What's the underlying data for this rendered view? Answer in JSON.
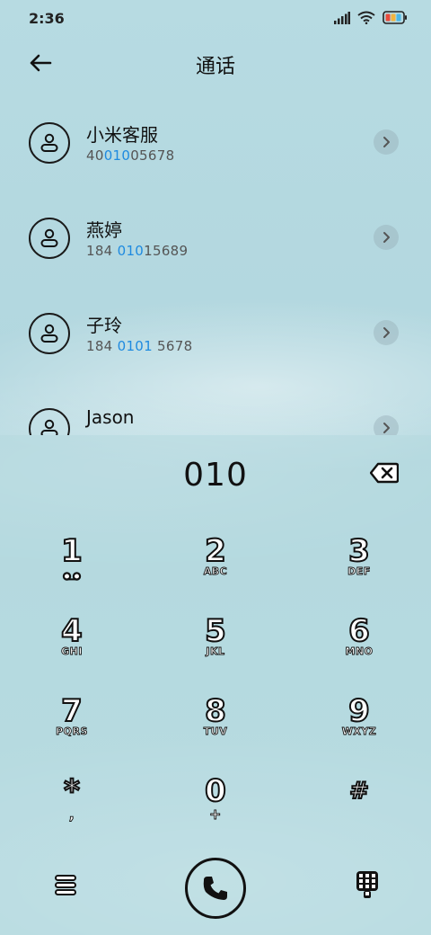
{
  "status": {
    "time": "2:36"
  },
  "header": {
    "title": "通话"
  },
  "contacts": [
    {
      "name": "小米客服",
      "num_pre": "40",
      "num_hl": "010",
      "num_post": "05678"
    },
    {
      "name": "燕婷",
      "num_pre": "184 ",
      "num_hl": "010",
      "num_post": "15689"
    },
    {
      "name": "子玲",
      "num_pre": "184 ",
      "num_hl": "0101",
      "num_post": " 5678"
    },
    {
      "name": "Jason",
      "num_pre": "",
      "num_hl": "",
      "num_post": ""
    }
  ],
  "dialpad": {
    "input": "010",
    "keys": [
      {
        "digit": "1",
        "letters": ""
      },
      {
        "digit": "2",
        "letters": "ABC"
      },
      {
        "digit": "3",
        "letters": "DEF"
      },
      {
        "digit": "4",
        "letters": "GHI"
      },
      {
        "digit": "5",
        "letters": "JKL"
      },
      {
        "digit": "6",
        "letters": "MNO"
      },
      {
        "digit": "7",
        "letters": "PQRS"
      },
      {
        "digit": "8",
        "letters": "TUV"
      },
      {
        "digit": "9",
        "letters": "WXYZ"
      },
      {
        "digit": "*",
        "letters": ","
      },
      {
        "digit": "0",
        "letters": "+"
      },
      {
        "digit": "#",
        "letters": ""
      }
    ]
  },
  "colors": {
    "highlight": "#1e8ae0",
    "background": "#b5d8df"
  }
}
